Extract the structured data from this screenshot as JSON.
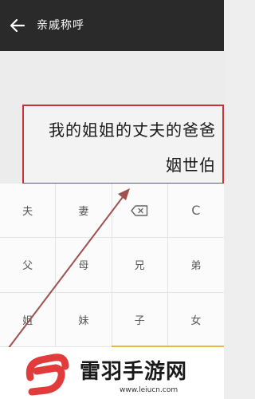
{
  "header": {
    "title": "亲戚称呼",
    "back_icon": "back-arrow-icon"
  },
  "display": {
    "expression": "我的姐姐的丈夫的爸爸",
    "result": "姻世伯"
  },
  "keypad": {
    "row1": [
      "夫",
      "妻",
      "",
      "C"
    ],
    "row2": [
      "父",
      "母",
      "兄",
      "弟"
    ],
    "row3": [
      "姐",
      "妹",
      "子",
      "女"
    ],
    "backspace_icon": "backspace-icon"
  },
  "colors": {
    "header_bg": "#2a2a2a",
    "highlight_border": "#c7333a",
    "arrow": "#a05050",
    "accent_underline": "#e8b64a",
    "logo_red": "#e23b3b"
  },
  "watermark": {
    "name": "雷羽手游网",
    "url": "www.leiucn.com"
  }
}
